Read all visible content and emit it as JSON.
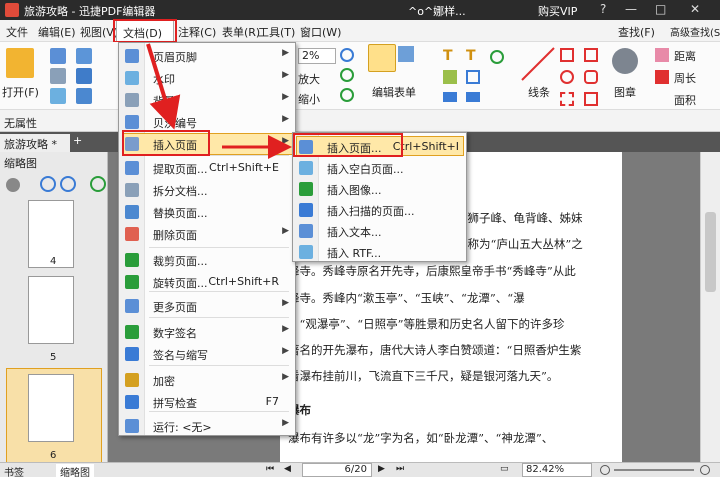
{
  "titlebar": {
    "title": "旅游攻略 - 迅捷PDF编辑器",
    "user": "^o^娜样...",
    "buy": "购买VIP"
  },
  "menubar": [
    "文件",
    "编辑(E)",
    "视图(V)",
    "文档(D)",
    "注释(C)",
    "表单(R)",
    "工具(T)",
    "窗口(W)"
  ],
  "toolbar": {
    "open": "打开(F)",
    "zoom": "2%",
    "enlarge": "放大",
    "shrink": "缩小",
    "edit_form": "编辑表单",
    "lines": "线条",
    "stamp": "图章",
    "find": "查找(F)",
    "adv_find": "高级查找(S)",
    "distance": "距离",
    "perimeter": "周长",
    "area": "面积"
  },
  "propbar": {
    "label": "无属性"
  },
  "tabs": {
    "doc_tab": "旅游攻略 *",
    "add": "+"
  },
  "sidebar": {
    "title": "缩略图",
    "pages": [
      "4",
      "5",
      "6"
    ],
    "bottom_tabs": [
      "书签",
      "缩略图"
    ]
  },
  "menu_doc": {
    "items": [
      {
        "label": "页眉页脚",
        "shortcut": "",
        "arrow": true
      },
      {
        "label": "水印",
        "shortcut": "",
        "arrow": true
      },
      {
        "label": "背景",
        "shortcut": "",
        "arrow": true
      },
      {
        "label": "贝茨编号",
        "shortcut": "",
        "arrow": true
      },
      {
        "label": "插入页面",
        "shortcut": "",
        "arrow": true
      },
      {
        "label": "提取页面...",
        "shortcut": "Ctrl+Shift+E",
        "arrow": false
      },
      {
        "label": "拆分文档...",
        "shortcut": "",
        "arrow": false
      },
      {
        "label": "替换页面...",
        "shortcut": "",
        "arrow": false
      },
      {
        "label": "删除页面",
        "shortcut": "",
        "arrow": true
      },
      {
        "label": "裁剪页面...",
        "shortcut": "",
        "arrow": false
      },
      {
        "label": "旋转页面...",
        "shortcut": "Ctrl+Shift+R",
        "arrow": false
      },
      {
        "label": "更多页面",
        "shortcut": "",
        "arrow": true
      },
      {
        "label": "数字签名",
        "shortcut": "",
        "arrow": true
      },
      {
        "label": "签名与缩写",
        "shortcut": "",
        "arrow": true
      },
      {
        "label": "加密",
        "shortcut": "",
        "arrow": true
      },
      {
        "label": "拼写检查",
        "shortcut": "F7",
        "arrow": false
      },
      {
        "label": "运行: <无>",
        "shortcut": "",
        "arrow": true
      }
    ]
  },
  "menu_insert": {
    "items": [
      {
        "label": "插入页面...",
        "shortcut": "Ctrl+Shift+I"
      },
      {
        "label": "插入空白页面...",
        "shortcut": ""
      },
      {
        "label": "插入图像...",
        "shortcut": ""
      },
      {
        "label": "插入扫描的页面...",
        "shortcut": ""
      },
      {
        "label": "插入文本...",
        "shortcut": ""
      },
      {
        "label": "插入 RTF...",
        "shortcut": ""
      }
    ]
  },
  "document": {
    "lines": [
      "、狮子峰、龟背峰、姊妹",
      "被称为“庐山五大丛林”之",
      "峰寺。秀峰寺原名开先寺，后康熙皇帝手书“秀峰寺”从此",
      "峰寺。秀峰内“漱玉亭”、“玉峡”、“龙潭”、“瀑",
      "、“观瀑亭”、“日照亭”等胜景和历史名人留下的许多珍",
      "著名的开先瀑布，唐代大诗人李白赞颂道：“日照香炉生紫",
      "看瀑布挂前川，飞流直下三千尺，疑是银河落九天”。",
      "瀑布",
      "瀑布有许多以“龙”字为名，如“卧龙潭”、“神龙潭”、"
    ]
  },
  "status": {
    "page": "6/20",
    "zoom": "82.42%"
  },
  "colors": {
    "highlight": "#ffe8a8",
    "annotation": "#e02020",
    "titlebar": "#2b2b2b"
  }
}
